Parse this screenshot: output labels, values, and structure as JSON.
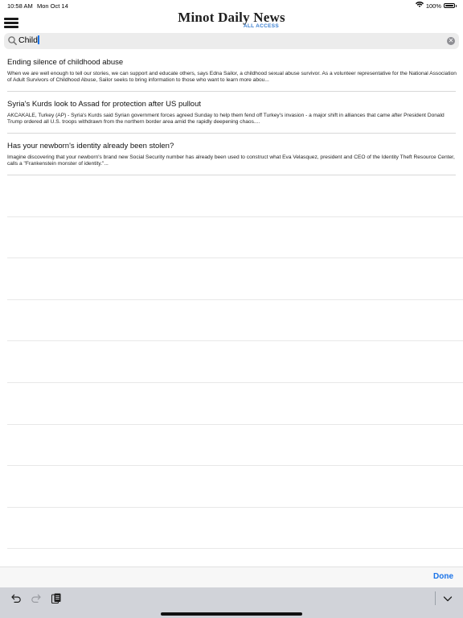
{
  "status": {
    "time": "10:58 AM",
    "date": "Mon Oct 14",
    "battery": "100%",
    "battery_level": 1.0
  },
  "header": {
    "title": "Minot Daily News",
    "subtitle": "ALL ACCESS",
    "menu_icon": "hamburger-menu-icon"
  },
  "search": {
    "query": "Child",
    "icon": "search-icon",
    "clear_icon": "clear-icon"
  },
  "results": [
    {
      "title": "Ending silence of childhood abuse",
      "snippet": "When we are well enough to tell our stories, we can support and educate others, says Edna Sailor, a childhood sexual abuse survivor. As a volunteer representative for the National Association of Adult Survivors of Childhood Abuse, Sailor seeks to bring information to those who want to learn more abou..."
    },
    {
      "title": "Syria's Kurds look to Assad for protection after US pullout",
      "snippet": "AKCAKALE, Turkey (AP) - Syria's Kurds said Syrian government forces agreed Sunday to help them fend off Turkey's invasion - a major shift in alliances that came after President Donald Trump ordered all U.S. troops withdrawn from the northern border area amid the rapidly deepening chaos...."
    },
    {
      "title": "Has your newborn's identity already been stolen?",
      "snippet": "Imagine discovering that your newborn's brand new Social Security number has already been used to construct what Eva Velasquez, president and CEO of the Identity Theft Resource Center, calls a \"Frankenstein monster of identity.\"..."
    }
  ],
  "keyboard_toolbar": {
    "done_label": "Done",
    "icons": [
      "undo-icon",
      "redo-icon",
      "paste-icon",
      "chevron-down-icon"
    ]
  },
  "colors": {
    "accent": "#1a73e8",
    "logo_sub": "#3a7fd0",
    "toolbar_bg": "#d1d3d9"
  }
}
